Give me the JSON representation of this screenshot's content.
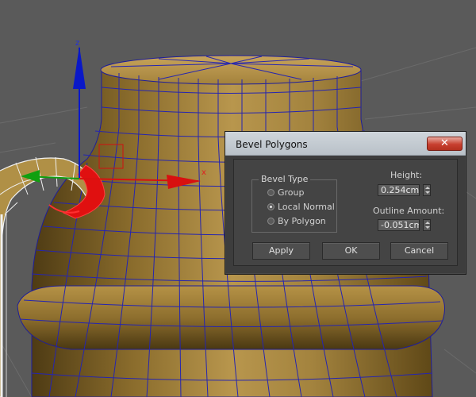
{
  "dialog": {
    "title": "Bevel Polygons",
    "close_label": "✕",
    "bevel_type": {
      "legend": "Bevel Type",
      "options": [
        {
          "label": "Group",
          "checked": false
        },
        {
          "label": "Local Normal",
          "checked": true
        },
        {
          "label": "By Polygon",
          "checked": false
        }
      ]
    },
    "height": {
      "label": "Height:",
      "value": "0.254cm"
    },
    "outline": {
      "label": "Outline Amount:",
      "value": "-0.051cm"
    },
    "buttons": {
      "apply": "Apply",
      "ok": "OK",
      "cancel": "Cancel"
    }
  },
  "viewport": {
    "gizmo_z_label": "z",
    "gizmo_x_label": "x",
    "colors": {
      "background": "#5a5a5a",
      "mesh_fill": "#9a7d3a",
      "wire": "#2a2ab8",
      "selection": "#e01010",
      "gizmo_z": "#0a18c8",
      "gizmo_x": "#d81010",
      "gizmo_y": "#10a010"
    }
  }
}
